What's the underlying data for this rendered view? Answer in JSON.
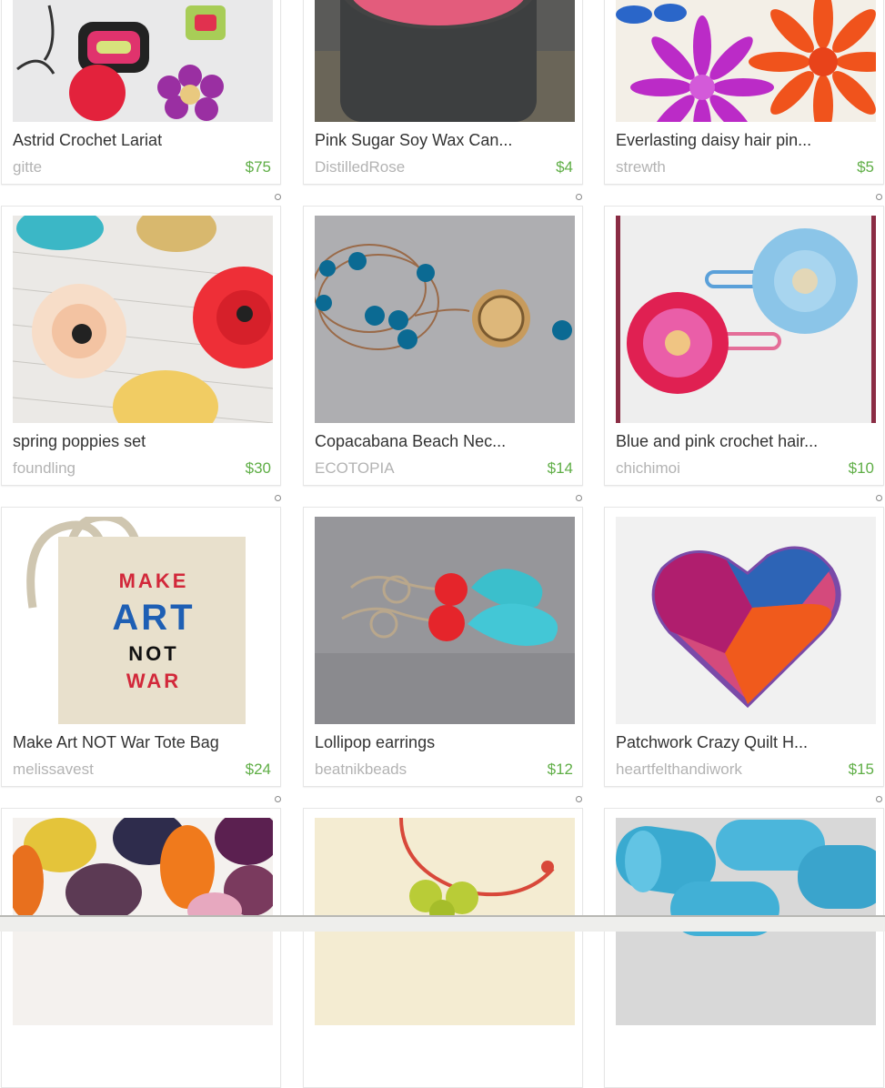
{
  "listings": [
    {
      "title": "Astrid Crochet Lariat",
      "shop": "gitte",
      "price": "$75",
      "image": "crochet-lariat"
    },
    {
      "title": "Pink Sugar Soy Wax Can...",
      "shop": "DistilledRose",
      "price": "$4",
      "image": "candle-tin"
    },
    {
      "title": "Everlasting daisy hair pin...",
      "shop": "strewth",
      "price": "$5",
      "image": "daisy-pins"
    },
    {
      "title": "spring poppies set",
      "shop": "foundling",
      "price": "$30",
      "image": "fabric-poppies"
    },
    {
      "title": "Copacabana Beach Nec...",
      "shop": "ECOTOPIA",
      "price": "$14",
      "image": "bead-necklace"
    },
    {
      "title": "Blue and pink crochet hair...",
      "shop": "chichimoi",
      "price": "$10",
      "image": "crochet-clips"
    },
    {
      "title": "Make Art NOT War Tote Bag",
      "shop": "melissavest",
      "price": "$24",
      "image": "tote-bag"
    },
    {
      "title": "Lollipop earrings",
      "shop": "beatnikbeads",
      "price": "$12",
      "image": "heart-earrings"
    },
    {
      "title": "Patchwork Crazy Quilt H...",
      "shop": "heartfelthandiwork",
      "price": "$15",
      "image": "felt-heart"
    },
    {
      "title": "",
      "shop": "",
      "price": "",
      "image": "felt-hearts"
    },
    {
      "title": "",
      "shop": "",
      "price": "",
      "image": "pendant"
    },
    {
      "title": "",
      "shop": "",
      "price": "",
      "image": "blue-rolls"
    }
  ],
  "tote_text": [
    "MAKE",
    "ART",
    "NOT",
    "WAR"
  ],
  "colors": {
    "price": "#5fae46",
    "shop": "#b3b3b3",
    "title": "#333333"
  }
}
